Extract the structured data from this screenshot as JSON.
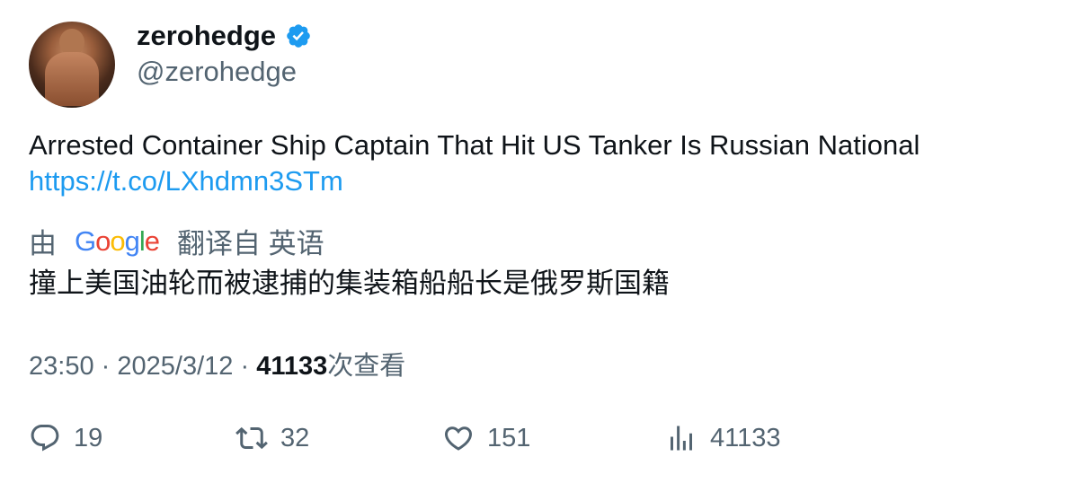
{
  "author": {
    "display_name": "zerohedge",
    "handle": "@zerohedge",
    "verified": true,
    "verified_color": "#1d9bf0"
  },
  "tweet": {
    "text": "Arrested Container Ship Captain That Hit US Tanker Is Russian National",
    "link": "https://t.co/LXhdmn3STm",
    "link_color": "#1d9bf0"
  },
  "translation": {
    "prefix": "由",
    "provider": "Google",
    "suffix": "翻译自 英语",
    "text": "撞上美国油轮而被逮捕的集装箱船船长是俄罗斯国籍"
  },
  "meta": {
    "time": "23:50",
    "separator": "·",
    "date": "2025/3/12",
    "views_count": "41133",
    "views_label": "次查看"
  },
  "actions": {
    "replies": "19",
    "retweets": "32",
    "likes": "151",
    "views": "41133"
  },
  "icons": [
    "verified-badge-icon",
    "reply-icon",
    "retweet-icon",
    "like-icon",
    "views-icon"
  ]
}
